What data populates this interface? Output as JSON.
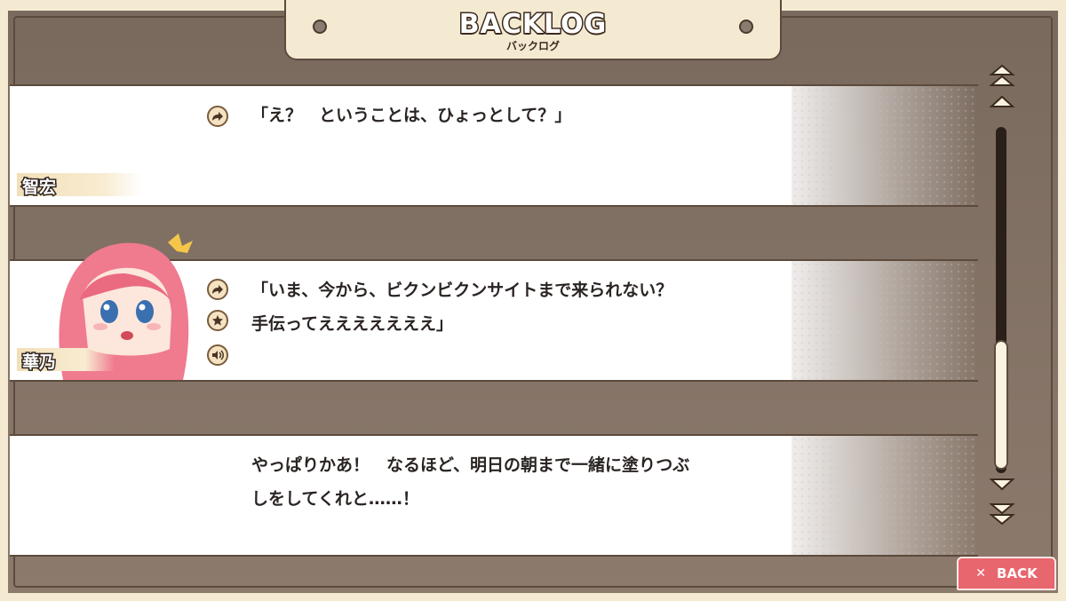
{
  "header": {
    "title": "BACKLOG",
    "subtitle": "バックログ"
  },
  "entries": [
    {
      "speaker": "智宏",
      "lines": [
        "「え？　ということは、ひょっとして？」"
      ],
      "icons": [
        "jump-icon"
      ]
    },
    {
      "speaker": "華乃",
      "lines": [
        "「いま、今から、ビクンビクンサイトまで来られない？",
        "手伝ってえええええええ」"
      ],
      "icons": [
        "jump-icon",
        "favorite-icon",
        "voice-replay-icon"
      ]
    },
    {
      "speaker": "",
      "lines": [
        "やっぱりかあ！　なるほど、明日の朝まで一緒に塗りつぶ",
        "しをしてくれと……！"
      ],
      "icons": []
    }
  ],
  "back_button": {
    "label": "BACK",
    "icon": "close-icon"
  },
  "colors": {
    "frame": "#f4ead2",
    "border": "#5c4b3c",
    "back": "#e8666e"
  }
}
